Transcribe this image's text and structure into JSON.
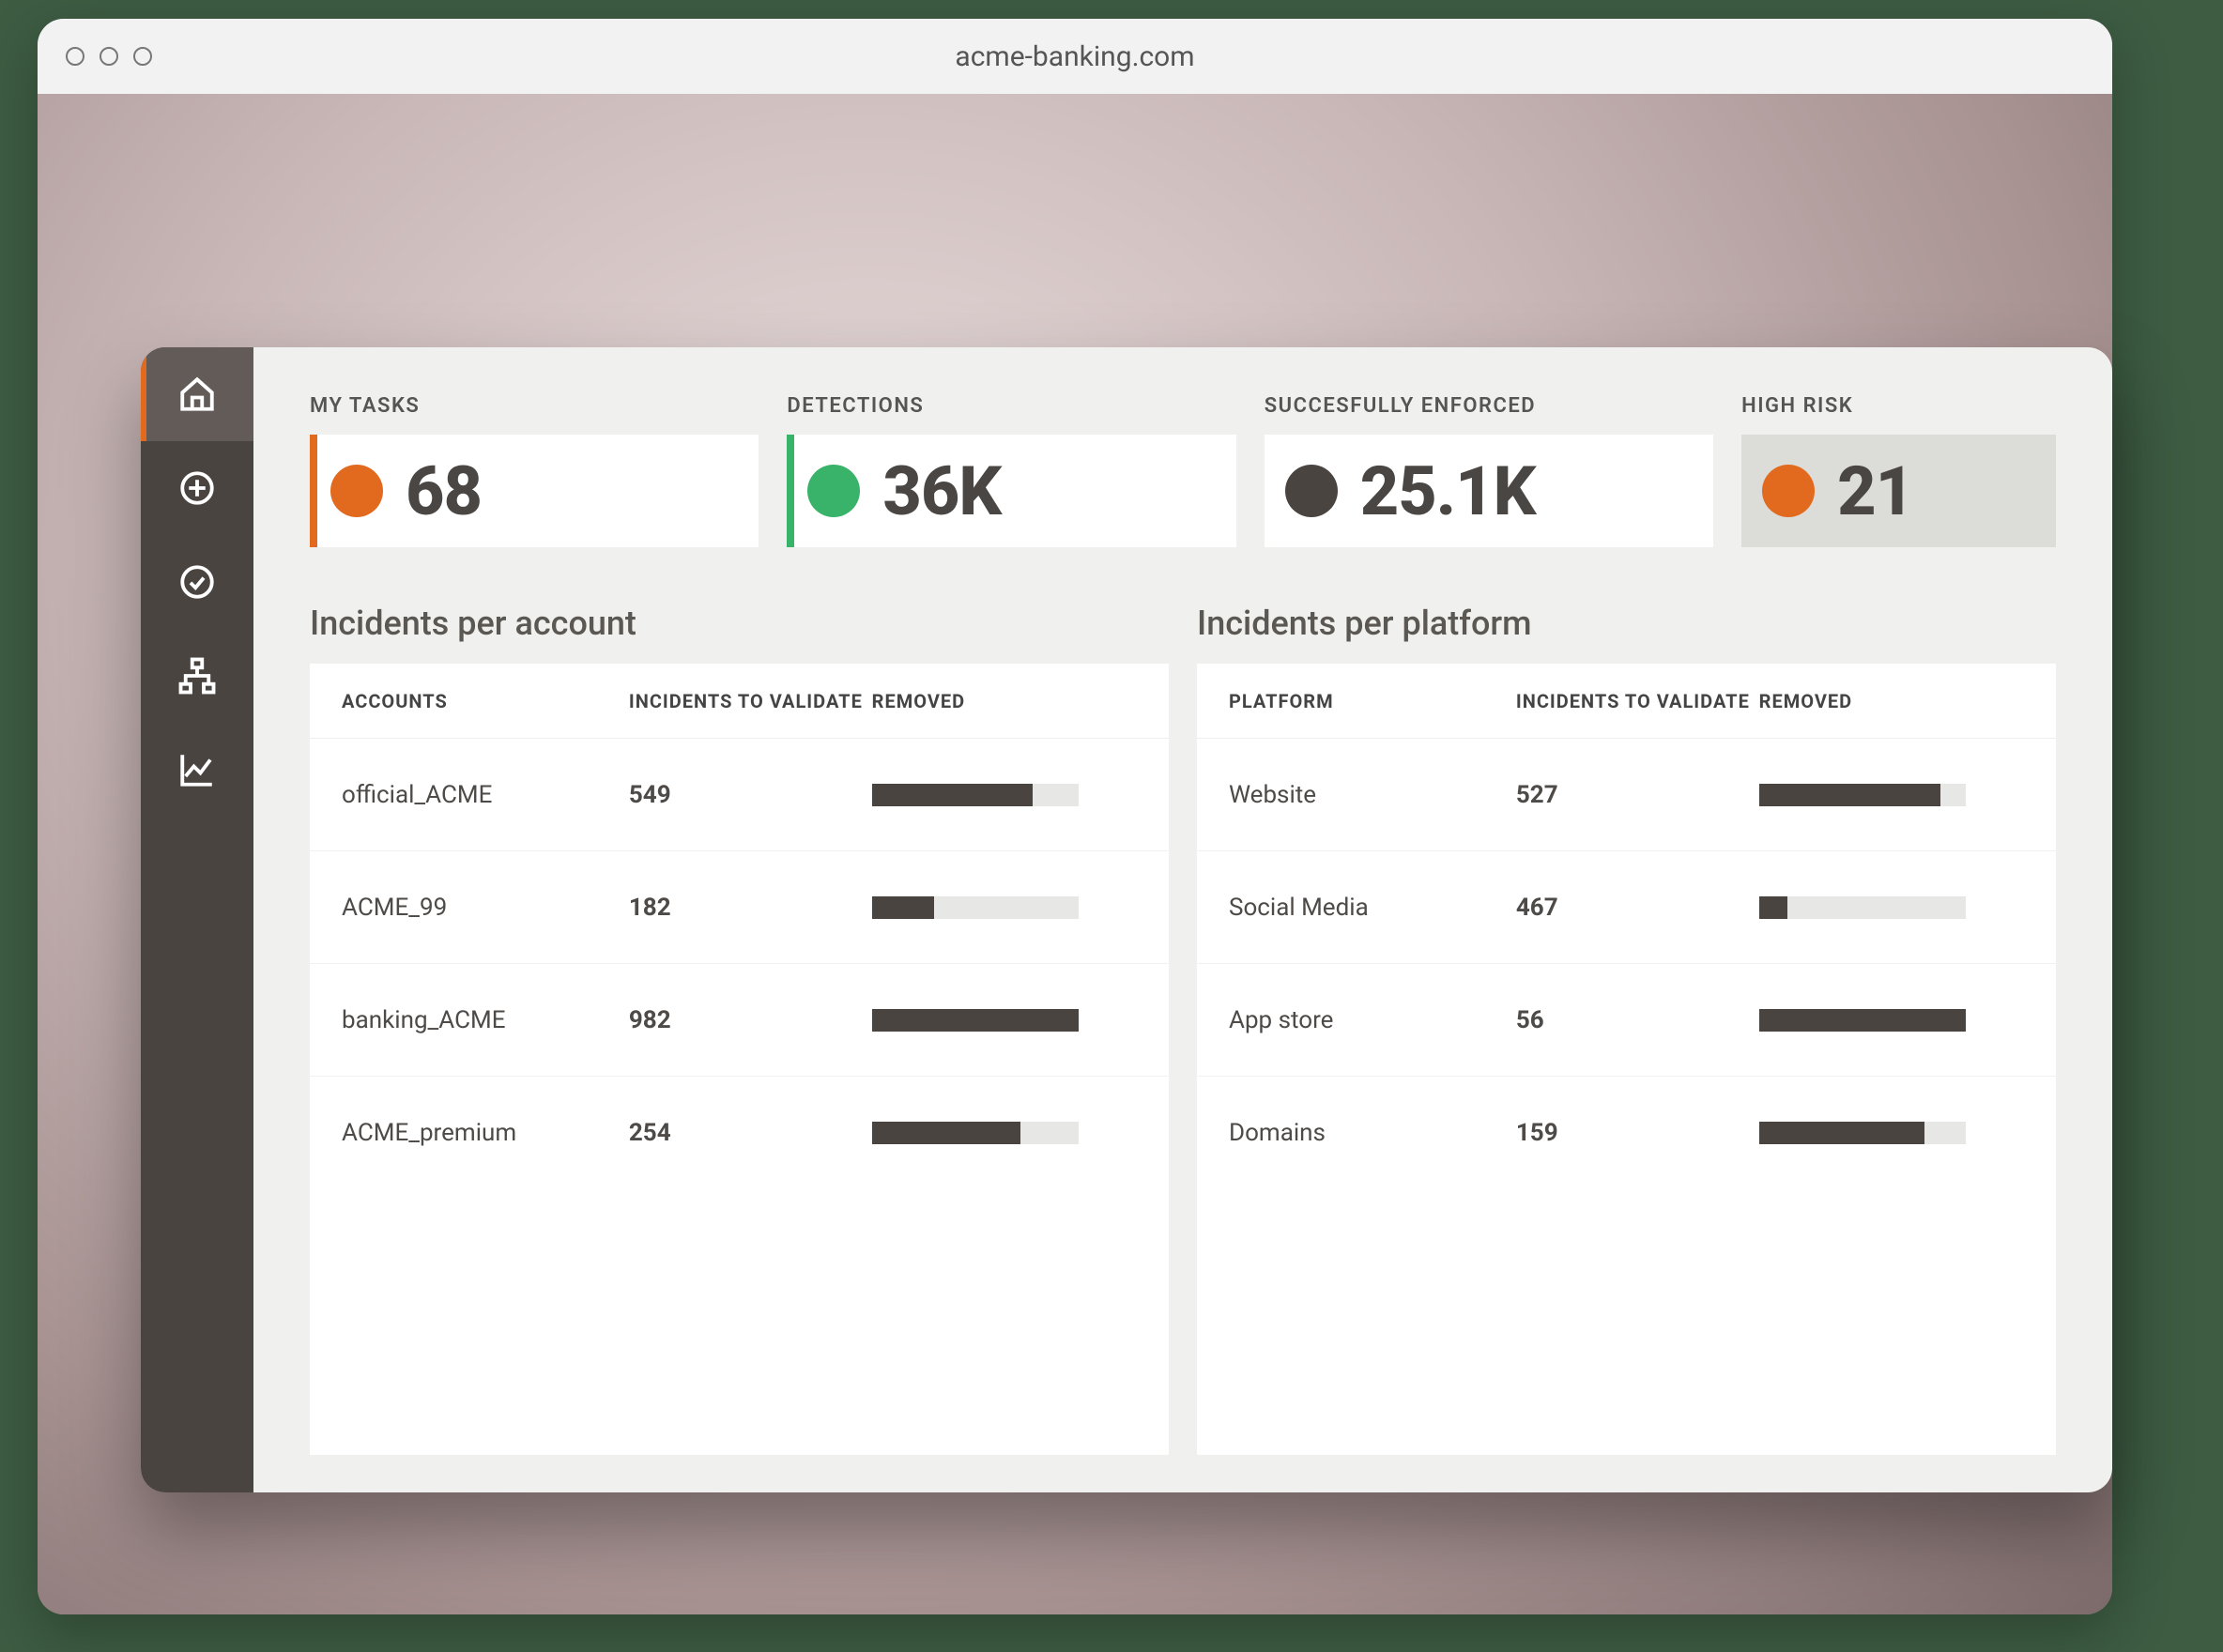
{
  "browser": {
    "url": "acme-banking.com"
  },
  "sidebar": {
    "items": [
      {
        "name": "home"
      },
      {
        "name": "add"
      },
      {
        "name": "validate"
      },
      {
        "name": "network"
      },
      {
        "name": "analytics"
      }
    ],
    "activeIndex": 0
  },
  "kpis": [
    {
      "label": "MY TASKS",
      "value": "68",
      "dot": "#e26a1e",
      "accent": "#e26a1e",
      "shaded": false
    },
    {
      "label": "DETECTIONS",
      "value": "36K",
      "dot": "#39b36a",
      "accent": "#39b36a",
      "shaded": false
    },
    {
      "label": "SUCCESFULLY ENFORCED",
      "value": "25.1K",
      "dot": "#4a4441",
      "accent": "",
      "shaded": false
    },
    {
      "label": "HIGH RISK",
      "value": "21",
      "dot": "#e26a1e",
      "accent": "",
      "shaded": true
    }
  ],
  "accountPanel": {
    "title": "Incidents per account",
    "headers": {
      "a": "ACCOUNTS",
      "b": "INCIDENTS TO VALIDATE",
      "c": "REMOVED"
    },
    "rows": [
      {
        "a": "official_ACME",
        "b": "549",
        "pct": 78
      },
      {
        "a": "ACME_99",
        "b": "182",
        "pct": 30
      },
      {
        "a": "banking_ACME",
        "b": "982",
        "pct": 100
      },
      {
        "a": "ACME_premium",
        "b": "254",
        "pct": 72
      }
    ]
  },
  "platformPanel": {
    "title": "Incidents per platform",
    "headers": {
      "a": "PLATFORM",
      "b": "INCIDENTS TO VALIDATE",
      "c": "REMOVED"
    },
    "rows": [
      {
        "a": "Website",
        "b": "527",
        "pct": 88
      },
      {
        "a": "Social Media",
        "b": "467",
        "pct": 14
      },
      {
        "a": "App store",
        "b": "56",
        "pct": 100
      },
      {
        "a": "Domains",
        "b": "159",
        "pct": 80
      }
    ]
  }
}
